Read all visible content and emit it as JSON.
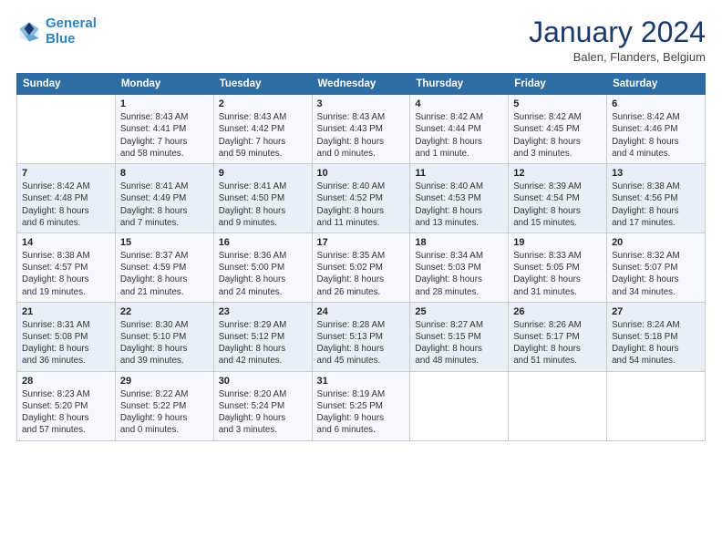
{
  "header": {
    "logo_line1": "General",
    "logo_line2": "Blue",
    "month_title": "January 2024",
    "location": "Balen, Flanders, Belgium"
  },
  "days_of_week": [
    "Sunday",
    "Monday",
    "Tuesday",
    "Wednesday",
    "Thursday",
    "Friday",
    "Saturday"
  ],
  "weeks": [
    [
      {
        "day": "",
        "info": ""
      },
      {
        "day": "1",
        "info": "Sunrise: 8:43 AM\nSunset: 4:41 PM\nDaylight: 7 hours\nand 58 minutes."
      },
      {
        "day": "2",
        "info": "Sunrise: 8:43 AM\nSunset: 4:42 PM\nDaylight: 7 hours\nand 59 minutes."
      },
      {
        "day": "3",
        "info": "Sunrise: 8:43 AM\nSunset: 4:43 PM\nDaylight: 8 hours\nand 0 minutes."
      },
      {
        "day": "4",
        "info": "Sunrise: 8:42 AM\nSunset: 4:44 PM\nDaylight: 8 hours\nand 1 minute."
      },
      {
        "day": "5",
        "info": "Sunrise: 8:42 AM\nSunset: 4:45 PM\nDaylight: 8 hours\nand 3 minutes."
      },
      {
        "day": "6",
        "info": "Sunrise: 8:42 AM\nSunset: 4:46 PM\nDaylight: 8 hours\nand 4 minutes."
      }
    ],
    [
      {
        "day": "7",
        "info": "Sunrise: 8:42 AM\nSunset: 4:48 PM\nDaylight: 8 hours\nand 6 minutes."
      },
      {
        "day": "8",
        "info": "Sunrise: 8:41 AM\nSunset: 4:49 PM\nDaylight: 8 hours\nand 7 minutes."
      },
      {
        "day": "9",
        "info": "Sunrise: 8:41 AM\nSunset: 4:50 PM\nDaylight: 8 hours\nand 9 minutes."
      },
      {
        "day": "10",
        "info": "Sunrise: 8:40 AM\nSunset: 4:52 PM\nDaylight: 8 hours\nand 11 minutes."
      },
      {
        "day": "11",
        "info": "Sunrise: 8:40 AM\nSunset: 4:53 PM\nDaylight: 8 hours\nand 13 minutes."
      },
      {
        "day": "12",
        "info": "Sunrise: 8:39 AM\nSunset: 4:54 PM\nDaylight: 8 hours\nand 15 minutes."
      },
      {
        "day": "13",
        "info": "Sunrise: 8:38 AM\nSunset: 4:56 PM\nDaylight: 8 hours\nand 17 minutes."
      }
    ],
    [
      {
        "day": "14",
        "info": "Sunrise: 8:38 AM\nSunset: 4:57 PM\nDaylight: 8 hours\nand 19 minutes."
      },
      {
        "day": "15",
        "info": "Sunrise: 8:37 AM\nSunset: 4:59 PM\nDaylight: 8 hours\nand 21 minutes."
      },
      {
        "day": "16",
        "info": "Sunrise: 8:36 AM\nSunset: 5:00 PM\nDaylight: 8 hours\nand 24 minutes."
      },
      {
        "day": "17",
        "info": "Sunrise: 8:35 AM\nSunset: 5:02 PM\nDaylight: 8 hours\nand 26 minutes."
      },
      {
        "day": "18",
        "info": "Sunrise: 8:34 AM\nSunset: 5:03 PM\nDaylight: 8 hours\nand 28 minutes."
      },
      {
        "day": "19",
        "info": "Sunrise: 8:33 AM\nSunset: 5:05 PM\nDaylight: 8 hours\nand 31 minutes."
      },
      {
        "day": "20",
        "info": "Sunrise: 8:32 AM\nSunset: 5:07 PM\nDaylight: 8 hours\nand 34 minutes."
      }
    ],
    [
      {
        "day": "21",
        "info": "Sunrise: 8:31 AM\nSunset: 5:08 PM\nDaylight: 8 hours\nand 36 minutes."
      },
      {
        "day": "22",
        "info": "Sunrise: 8:30 AM\nSunset: 5:10 PM\nDaylight: 8 hours\nand 39 minutes."
      },
      {
        "day": "23",
        "info": "Sunrise: 8:29 AM\nSunset: 5:12 PM\nDaylight: 8 hours\nand 42 minutes."
      },
      {
        "day": "24",
        "info": "Sunrise: 8:28 AM\nSunset: 5:13 PM\nDaylight: 8 hours\nand 45 minutes."
      },
      {
        "day": "25",
        "info": "Sunrise: 8:27 AM\nSunset: 5:15 PM\nDaylight: 8 hours\nand 48 minutes."
      },
      {
        "day": "26",
        "info": "Sunrise: 8:26 AM\nSunset: 5:17 PM\nDaylight: 8 hours\nand 51 minutes."
      },
      {
        "day": "27",
        "info": "Sunrise: 8:24 AM\nSunset: 5:18 PM\nDaylight: 8 hours\nand 54 minutes."
      }
    ],
    [
      {
        "day": "28",
        "info": "Sunrise: 8:23 AM\nSunset: 5:20 PM\nDaylight: 8 hours\nand 57 minutes."
      },
      {
        "day": "29",
        "info": "Sunrise: 8:22 AM\nSunset: 5:22 PM\nDaylight: 9 hours\nand 0 minutes."
      },
      {
        "day": "30",
        "info": "Sunrise: 8:20 AM\nSunset: 5:24 PM\nDaylight: 9 hours\nand 3 minutes."
      },
      {
        "day": "31",
        "info": "Sunrise: 8:19 AM\nSunset: 5:25 PM\nDaylight: 9 hours\nand 6 minutes."
      },
      {
        "day": "",
        "info": ""
      },
      {
        "day": "",
        "info": ""
      },
      {
        "day": "",
        "info": ""
      }
    ]
  ]
}
